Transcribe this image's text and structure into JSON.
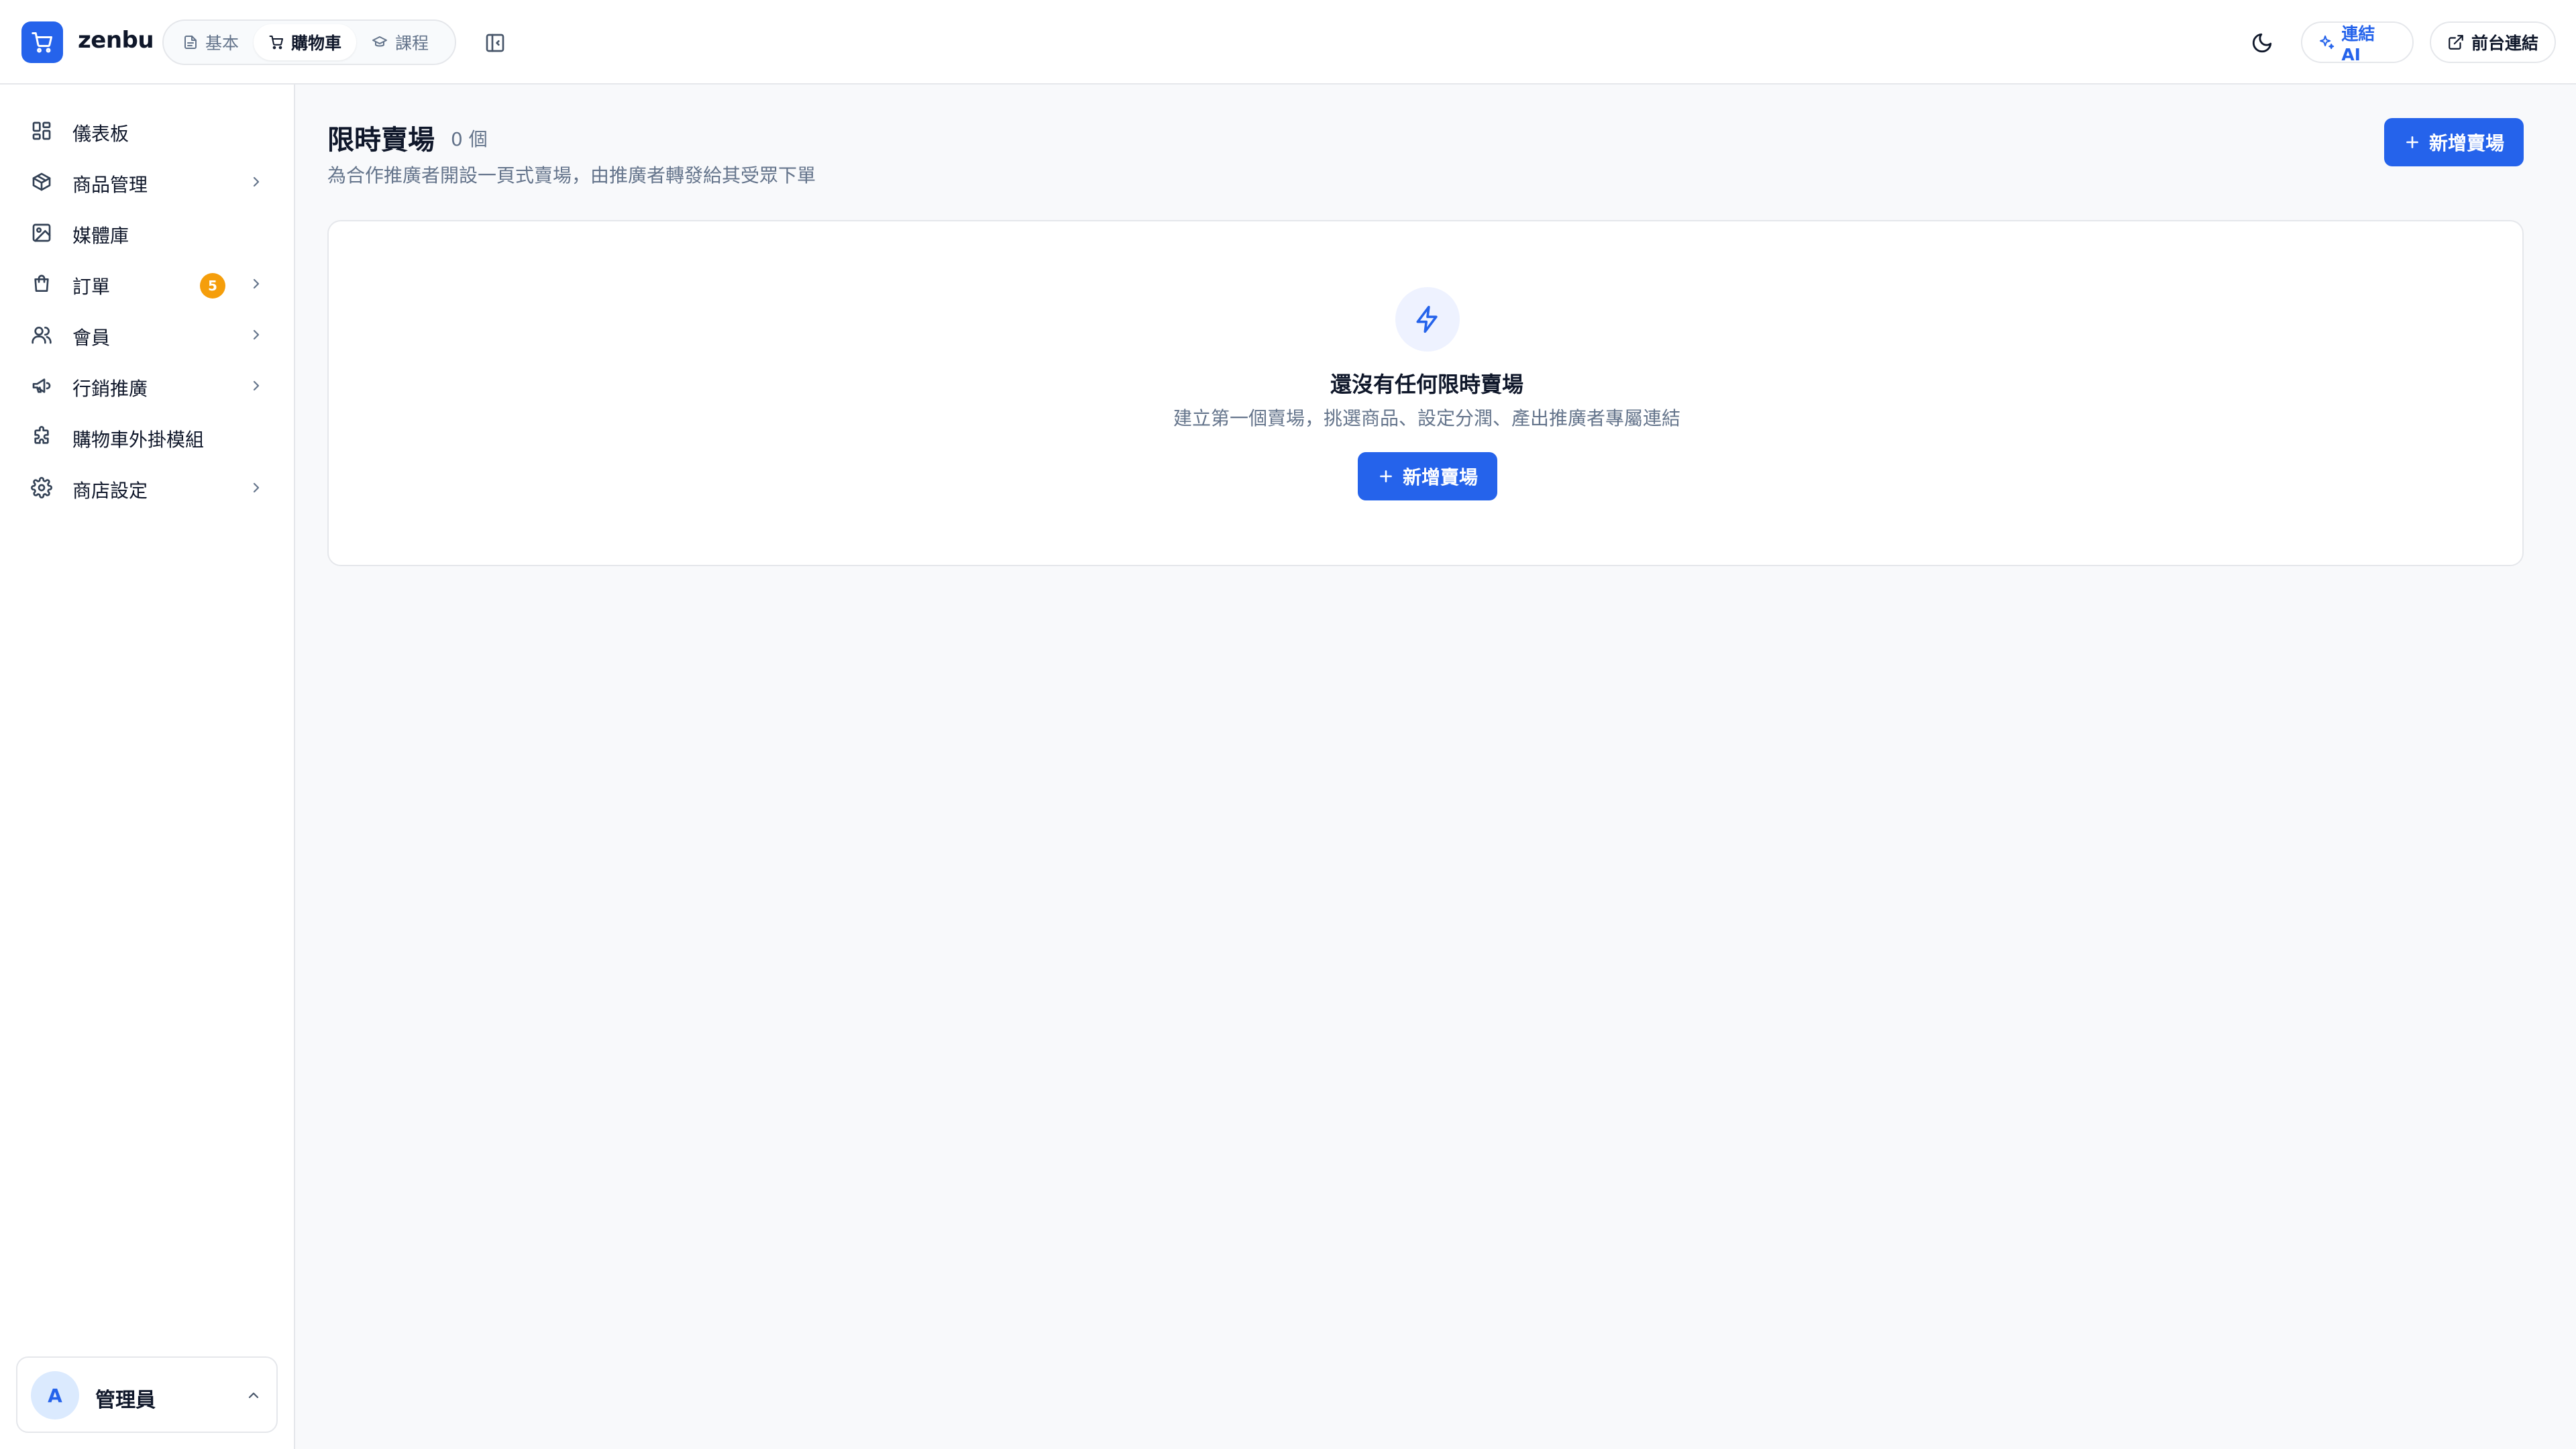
{
  "brand": {
    "name": "zenbu"
  },
  "modes": [
    {
      "label": "基本",
      "icon": "document-icon"
    },
    {
      "label": "購物車",
      "icon": "cart-icon",
      "active": true
    },
    {
      "label": "課程",
      "icon": "graduation-cap-icon"
    }
  ],
  "header_actions": {
    "ai_label": "連結 AI",
    "front_label": "前台連結"
  },
  "sidebar": {
    "items": [
      {
        "label": "儀表板",
        "icon": "dashboard-icon"
      },
      {
        "label": "商品管理",
        "icon": "package-icon",
        "chevron": true
      },
      {
        "label": "媒體庫",
        "icon": "image-icon"
      },
      {
        "label": "訂單",
        "icon": "shopping-bag-icon",
        "chevron": true,
        "badge": "5"
      },
      {
        "label": "會員",
        "icon": "users-icon",
        "chevron": true
      },
      {
        "label": "行銷推廣",
        "icon": "megaphone-icon",
        "chevron": true
      },
      {
        "label": "購物車外掛模組",
        "icon": "puzzle-icon"
      },
      {
        "label": "商店設定",
        "icon": "gear-icon",
        "chevron": true
      }
    ]
  },
  "user": {
    "initial": "A",
    "name": "管理員"
  },
  "page": {
    "title": "限時賣場",
    "count": "0 個",
    "subtitle": "為合作推廣者開設一頁式賣場，由推廣者轉發給其受眾下單",
    "add_label": "新增賣場"
  },
  "empty_state": {
    "icon": "lightning-icon",
    "title": "還沒有任何限時賣場",
    "description": "建立第一個賣場，挑選商品、設定分潤、產出推廣者專屬連結",
    "add_label": "新增賣場"
  },
  "colors": {
    "primary": "#2563eb",
    "badge": "#f59e0b",
    "border": "#e5e7eb",
    "muted_text": "#64748b"
  }
}
